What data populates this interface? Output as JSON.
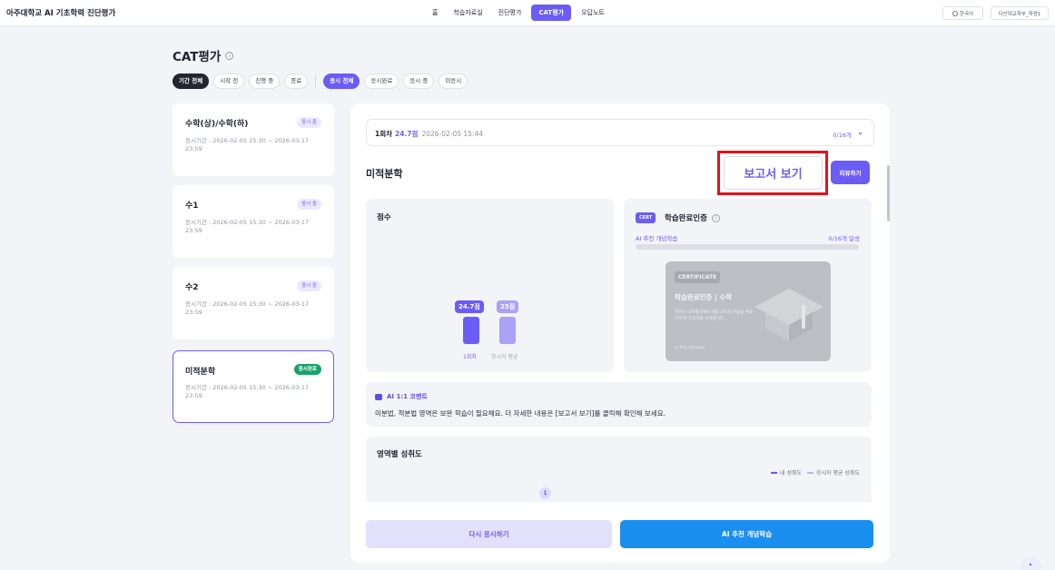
{
  "header": {
    "brand": "아주대학교 AI 기초학력 진단평가",
    "nav": [
      {
        "label": "홈",
        "active": false
      },
      {
        "label": "학습자료실",
        "active": false
      },
      {
        "label": "진단평가",
        "active": false
      },
      {
        "label": "CAT평가",
        "active": true
      },
      {
        "label": "오답노트",
        "active": false
      }
    ],
    "language": "한국어",
    "user": "다산대교학부_학생1",
    "accent_color": "#6b5cf6"
  },
  "page": {
    "title": "CAT평가",
    "period_filters": [
      "기간 전체",
      "시작 전",
      "진행 중",
      "종료"
    ],
    "status_filters": [
      "응시 전체",
      "응시완료",
      "응시 중",
      "미응시"
    ]
  },
  "exams": [
    {
      "name": "수학(상)/수학(하)",
      "badge": "응시 중",
      "period": "응시기간 : 2026-02-05 15:30 ~ 2026-03-17 23:59",
      "status": "in-progress"
    },
    {
      "name": "수1",
      "badge": "응시 중",
      "period": "응시기간 : 2026-02-05 15:30 ~ 2026-03-17 23:59",
      "status": "in-progress"
    },
    {
      "name": "수2",
      "badge": "응시 중",
      "period": "응시기간 : 2026-02-05 15:30 ~ 2026-03-17 23:59",
      "status": "in-progress"
    },
    {
      "name": "미적분학",
      "badge": "응시완료",
      "period": "응시기간 : 2026-02-05 15:30 ~ 2026-03-17 23:59",
      "status": "completed",
      "selected": true
    }
  ],
  "detail": {
    "round": "1회차",
    "round_score": "24.7점",
    "round_date": "2026-02-05 15:44",
    "round_count": "0/16개",
    "subject": "미적분학",
    "report_button": "보고서 보기",
    "review_button": "리뷰하기",
    "score_heading": "점수",
    "scores": {
      "my_label": "24.7점",
      "my_value": 24.7,
      "avg_label": "25점",
      "avg_value": 25,
      "my_category": "1회차",
      "avg_category": "응시자 평균",
      "my_color": "#6b5cf6",
      "avg_color": "#a9a2f7"
    },
    "cert": {
      "tag": "CERT",
      "title": "학습완료인증",
      "sub": "AI 추천 개념학습",
      "progress_text": "0/16개 달성",
      "progress": 0,
      "card_tag": "CERTIFICATE",
      "card_title": "학습완료인증 | 수학",
      "card_desc": "귀하는 CAT평가에서 해당 과목의 학습을 완료하여 본 인증서를 수여합니다.",
      "card_brand": "ai day campus"
    },
    "ai_heading": "AI 1:1 코멘트",
    "ai_comment": "미분법, 적분법 영역은 보완 학습이 필요해요. 더 자세한 내용은 [보고서 보기]를 클릭해 확인해 보세요.",
    "area_heading": "영역별 성취도",
    "legend_mine": "내 성취도",
    "legend_avg": "응시자 평균 성취도",
    "point_label": "1",
    "retake_button": "다시 응시하기",
    "study_button": "AI 추천 개념학습"
  }
}
